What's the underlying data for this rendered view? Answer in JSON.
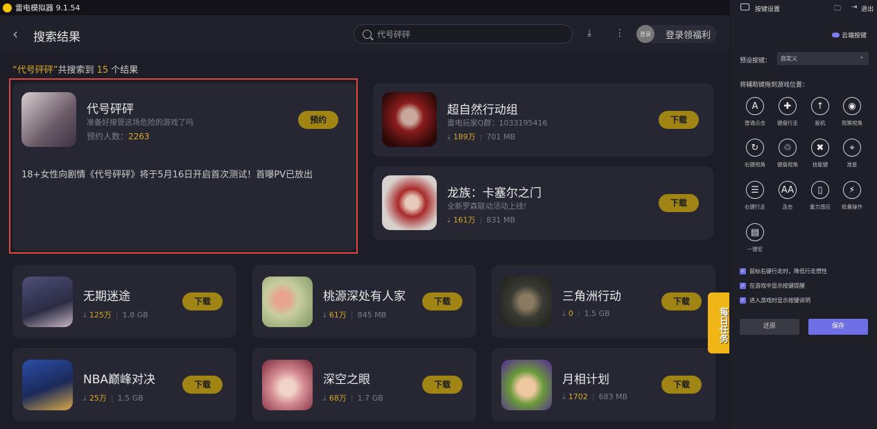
{
  "app": {
    "title": "雷电模拟器 9.1.54",
    "logo_char": "•"
  },
  "header": {
    "title": "搜索结果",
    "search_value": "代号砰砰",
    "login_avatar": "登录",
    "login_text": "登录领福利"
  },
  "summary": {
    "prefix": "“代号砰砰”",
    "middle": "共搜索到 ",
    "count": "15",
    "suffix": " 个结果"
  },
  "featured": {
    "name": "代号砰砰",
    "desc": "准备好接管这场危险的游戏了吗",
    "reserve_label": "预约人数：",
    "reserve_count": "2263",
    "button": "预约",
    "news": "18+女性向剧情《代号砰砰》将于5月16日开启首次测试！首曝PV已放出"
  },
  "side_games": [
    {
      "name": "超自然行动组",
      "sub": "雷电玩家Q群：1033195416",
      "downloads": "189万",
      "size": "701 MB",
      "button": "下载",
      "color": "#5a1414"
    },
    {
      "name": "龙族：卡塞尔之门",
      "sub": "全新罗森联动活动上线!",
      "downloads": "161万",
      "size": "831 MB",
      "button": "下载",
      "color": "#6b2020"
    }
  ],
  "grid_games": [
    {
      "name": "无期迷途",
      "downloads": "125万",
      "size": "1.8 GB",
      "button": "下载",
      "color": "#3a3c5a"
    },
    {
      "name": "桃源深处有人家",
      "downloads": "61万",
      "size": "845 MB",
      "button": "下载",
      "color": "#b7ba88"
    },
    {
      "name": "三角洲行动",
      "downloads": "0",
      "size": "1.5 GB",
      "button": "下载",
      "color": "#44463c"
    },
    {
      "name": "NBA巅峰对决",
      "downloads": "25万",
      "size": "1.5 GB",
      "button": "下载",
      "color": "#2c3d7c"
    },
    {
      "name": "深空之眼",
      "downloads": "68万",
      "size": "1.7 GB",
      "button": "下载",
      "color": "#c77a86"
    },
    {
      "name": "月相计划",
      "downloads": "1702",
      "size": "683 MB",
      "button": "下载",
      "color": "#5a7a3a"
    }
  ],
  "daily_task": "每日任务",
  "panel": {
    "title": "按键设置",
    "exit": "退出",
    "cloud": "云端按键",
    "preset_label": "预设按键：",
    "preset_value": "自定义",
    "drag_hint": "将辅助键拖到游戏位置：",
    "keys": [
      {
        "glyph": "A",
        "label": "普通点击",
        "icon": "tap-icon"
      },
      {
        "glyph": "✚",
        "label": "键盘行走",
        "icon": "dpad-icon"
      },
      {
        "glyph": "↑",
        "label": "扳机",
        "icon": "trigger-icon"
      },
      {
        "glyph": "◉",
        "label": "观察视角",
        "icon": "eye-icon"
      },
      {
        "glyph": "↻",
        "label": "右键视角",
        "icon": "right-view-icon"
      },
      {
        "glyph": "♲",
        "label": "键盘视角",
        "icon": "keyboard-view-icon"
      },
      {
        "glyph": "✖",
        "label": "技能键",
        "icon": "skill-icon"
      },
      {
        "glyph": "⌖",
        "label": "准星",
        "icon": "crosshair-icon"
      },
      {
        "glyph": "☰",
        "label": "右键行走",
        "icon": "mouse-icon"
      },
      {
        "glyph": "AA",
        "label": "连击",
        "icon": "combo-icon"
      },
      {
        "glyph": "▯",
        "label": "重力感应",
        "icon": "gravity-icon"
      },
      {
        "glyph": "⚡",
        "label": "批量操作",
        "icon": "batch-icon"
      },
      {
        "glyph": "▤",
        "label": "一键宏",
        "icon": "macro-icon"
      }
    ],
    "options": [
      "鼠标右键行走时，降低行走惯性",
      "在游戏中显示按键提醒",
      "进入游戏时显示按键说明"
    ],
    "reset": "还原",
    "save": "保存",
    "accent": "#6f6fe6"
  }
}
